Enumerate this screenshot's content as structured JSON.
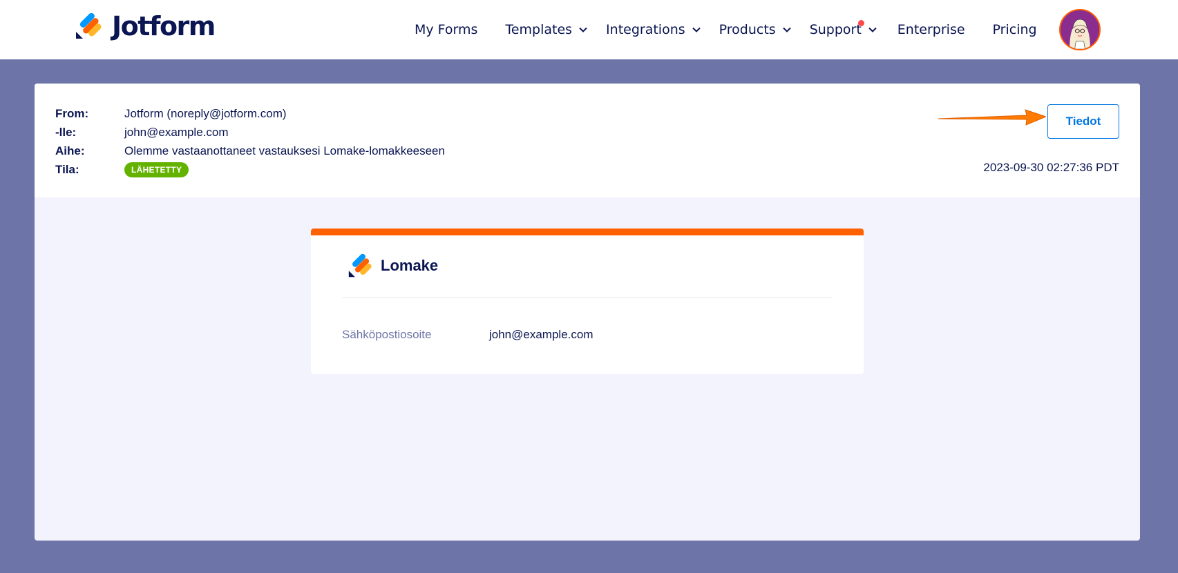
{
  "brand": {
    "name": "Jotform",
    "colors": {
      "navy": "#0a1551",
      "orange": "#ff6100",
      "blue": "#0075e3",
      "yellow": "#ffb629",
      "green": "#64b200",
      "background": "#6c74a8"
    }
  },
  "nav": {
    "items": [
      {
        "label": "My Forms",
        "has_dropdown": false
      },
      {
        "label": "Templates",
        "has_dropdown": true
      },
      {
        "label": "Integrations",
        "has_dropdown": true
      },
      {
        "label": "Products",
        "has_dropdown": true
      },
      {
        "label": "Support",
        "has_dropdown": true,
        "has_notification": true
      },
      {
        "label": "Enterprise",
        "has_dropdown": false
      },
      {
        "label": "Pricing",
        "has_dropdown": false
      }
    ],
    "avatar_icon": "user-avatar-icon"
  },
  "email": {
    "meta": [
      {
        "label": "From:",
        "value": "Jotform (noreply@jotform.com)"
      },
      {
        "label": "-lle:",
        "value": "john@example.com"
      },
      {
        "label": "Aihe:",
        "value": "Olemme vastaanottaneet vastauksesi Lomake-lomakkeeseen"
      },
      {
        "label": "Tila:",
        "value": "LÄHETETTY"
      }
    ],
    "details_button": "Tiedot",
    "timestamp": "2023-09-30 02:27:36 PDT",
    "preview": {
      "form_title": "Lomake",
      "field_label": "Sähköpostiosoite",
      "field_value": "john@example.com"
    }
  }
}
